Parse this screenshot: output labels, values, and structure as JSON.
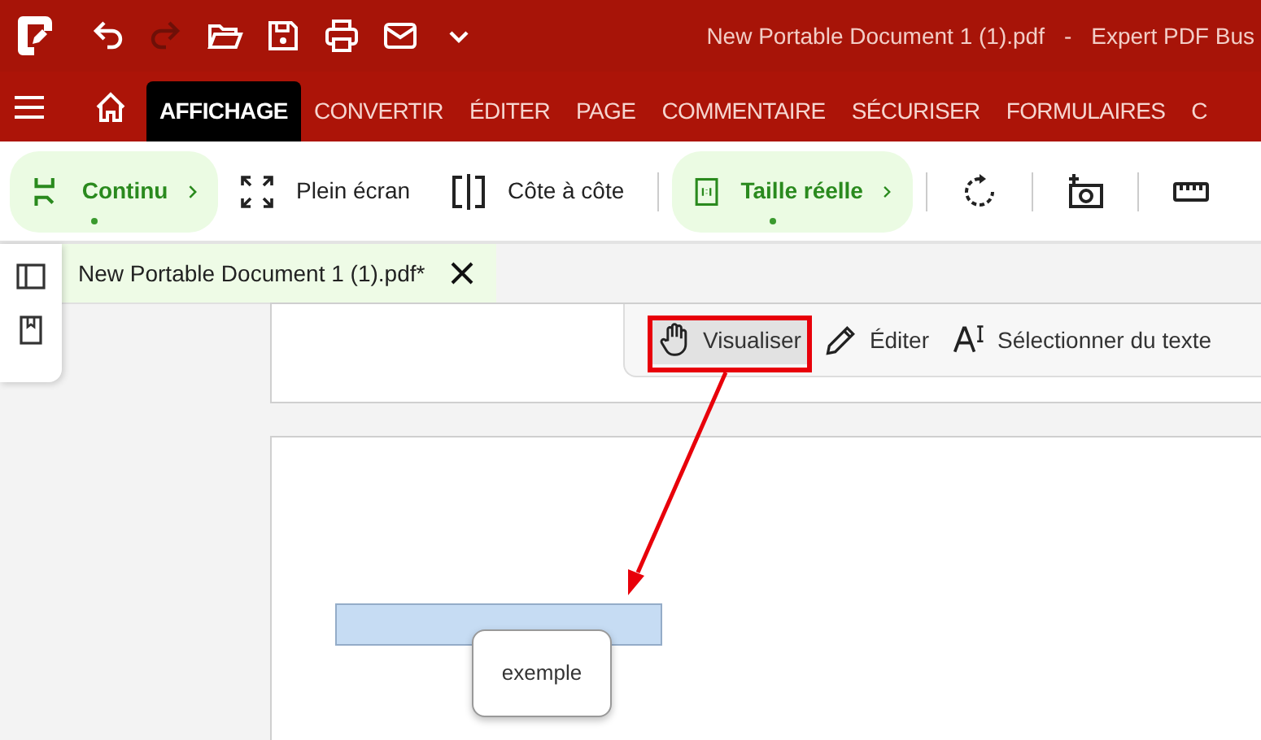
{
  "window": {
    "title_parts": [
      "New Portable Document 1 (1).pdf",
      "-",
      "Expert PDF Bus"
    ]
  },
  "quick_access": [
    {
      "kind": "undo",
      "disabled": false
    },
    {
      "kind": "redo",
      "disabled": true
    },
    {
      "kind": "open",
      "disabled": false
    },
    {
      "kind": "save",
      "disabled": false
    },
    {
      "kind": "print",
      "disabled": false
    },
    {
      "kind": "mail",
      "disabled": false
    },
    {
      "kind": "more",
      "disabled": false
    }
  ],
  "ribbon_tabs": [
    {
      "label": "AFFICHAGE",
      "selected": true
    },
    {
      "label": "CONVERTIR",
      "selected": false
    },
    {
      "label": "ÉDITER",
      "selected": false
    },
    {
      "label": "PAGE",
      "selected": false
    },
    {
      "label": "COMMENTAIRE",
      "selected": false
    },
    {
      "label": "SÉCURISER",
      "selected": false
    },
    {
      "label": "FORMULAIRES",
      "selected": false
    },
    {
      "label": "C",
      "selected": false
    }
  ],
  "toolbar": [
    {
      "kind": "pill",
      "label": "Continu",
      "selected": true
    },
    {
      "kind": "button",
      "label": "Plein écran",
      "selected": false
    },
    {
      "kind": "button",
      "label": "Côte à côte",
      "selected": false
    },
    {
      "kind": "separator"
    },
    {
      "kind": "pill",
      "label": "Taille réelle",
      "selected": true
    },
    {
      "kind": "separator"
    },
    {
      "kind": "icon"
    },
    {
      "kind": "separator"
    },
    {
      "kind": "icon"
    },
    {
      "kind": "separator"
    },
    {
      "kind": "icon"
    }
  ],
  "document_tab": {
    "label": "New Portable Document 1 (1).pdf*"
  },
  "mode_toolbar": [
    {
      "label": "Visualiser",
      "selected": true
    },
    {
      "label": "Éditer",
      "selected": false
    },
    {
      "label": "Sélectionner du texte",
      "selected": false
    }
  ],
  "page": {
    "tooltip": "exemple"
  }
}
